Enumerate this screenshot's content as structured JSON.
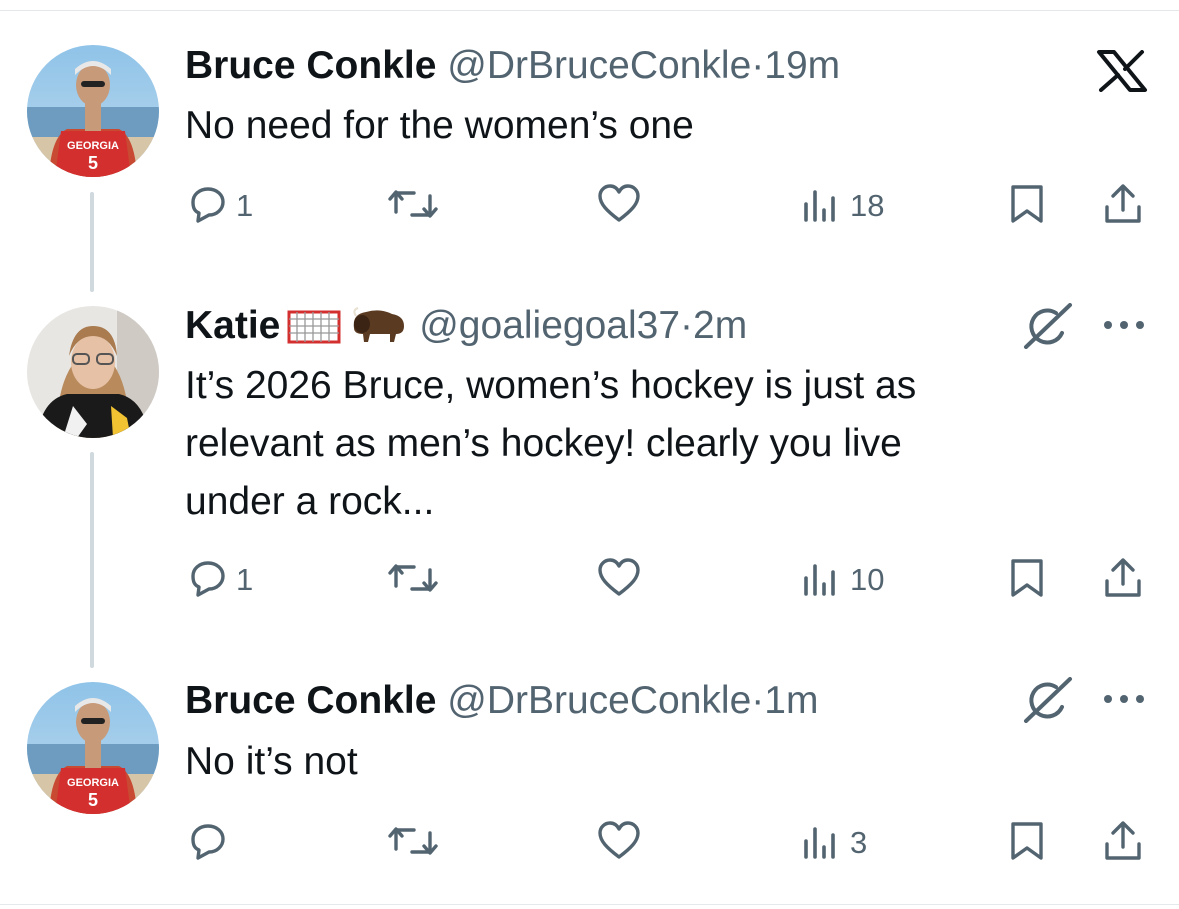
{
  "tweets": [
    {
      "name": "Bruce Conkle",
      "handle": "@DrBruceConkle",
      "dot": "·",
      "time": "19m",
      "text": "No need for the women’s one",
      "avatar": {
        "jersey_text": "GEORGIA",
        "jersey_number": "5"
      },
      "replies": "1",
      "views": "18"
    },
    {
      "name": "Katie",
      "emojis": [
        "goal-net-emoji",
        "bison-emoji"
      ],
      "handle": "@goaliegoal37",
      "dot": "·",
      "time": "2m",
      "text_lines": [
        "It’s 2026 Bruce, women’s hockey is just as",
        "relevant as men’s hockey! clearly you live",
        "under a rock..."
      ],
      "replies": "1",
      "views": "10"
    },
    {
      "name": "Bruce Conkle",
      "handle": "@DrBruceConkle",
      "dot": "·",
      "time": "1m",
      "text": "No it’s not",
      "avatar": {
        "jersey_text": "GEORGIA",
        "jersey_number": "5"
      },
      "replies": "",
      "views": "3"
    }
  ],
  "icons": {
    "reply": "speech-bubble-icon",
    "retweet": "retweet-icon",
    "like": "heart-icon",
    "views": "bar-chart-icon",
    "bookmark": "bookmark-icon",
    "share": "share-icon",
    "brand": "x-logo-icon",
    "grok": "grok-icon",
    "more": "more-dots-icon"
  },
  "colors": {
    "text": "#0f1419",
    "muted": "#536471",
    "thread": "#cfd9de",
    "jersey": "#d32f2f"
  }
}
